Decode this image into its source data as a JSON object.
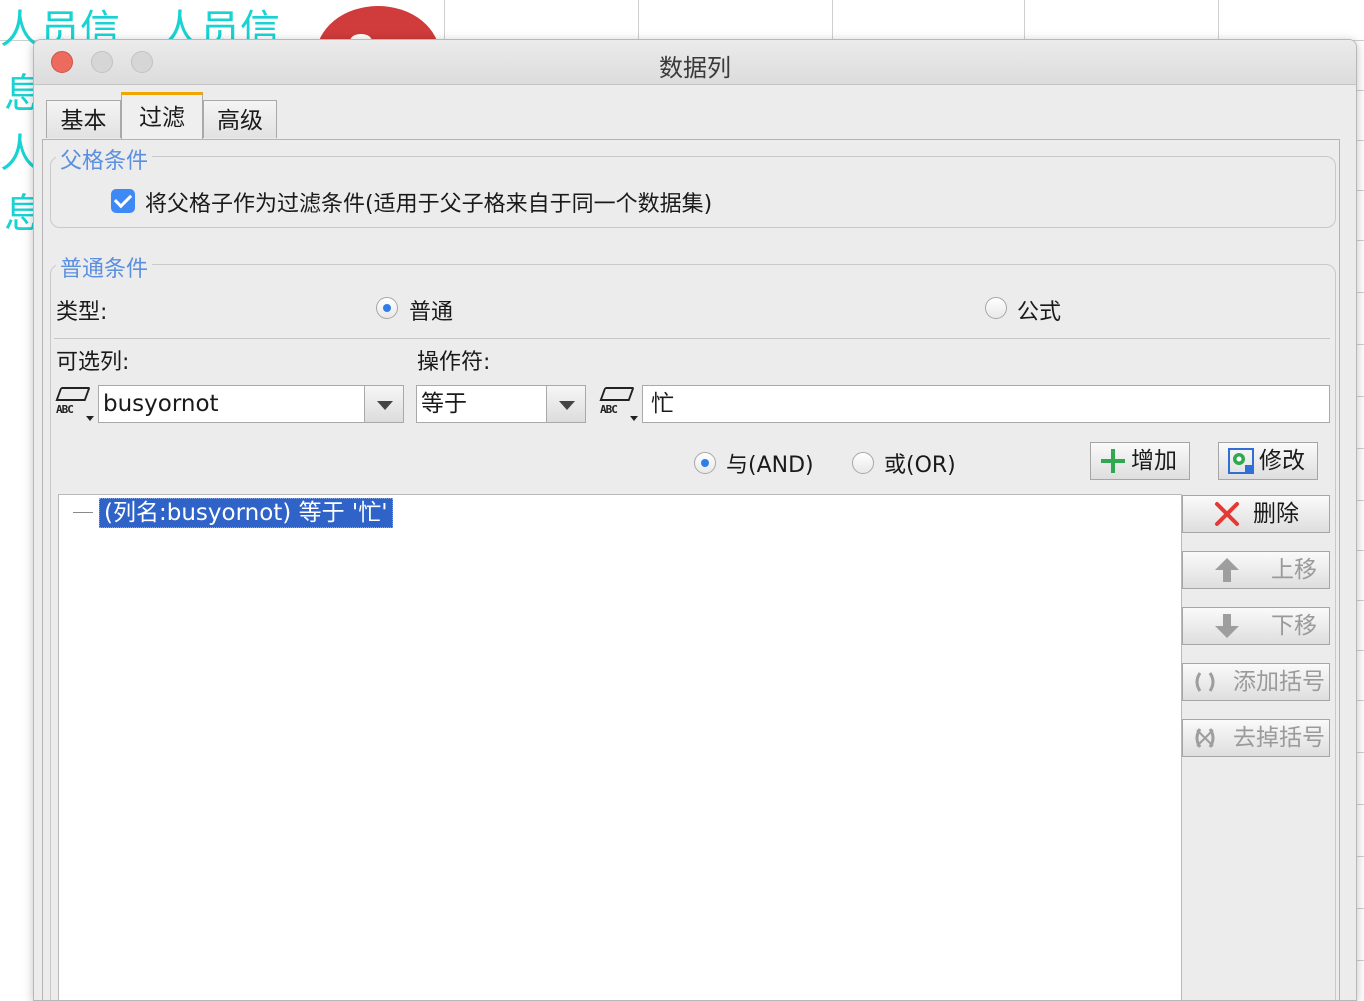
{
  "background": {
    "cyan_texts": [
      "人员信",
      "人员信",
      "息",
      "人",
      "息"
    ]
  },
  "dialog": {
    "title": "数据列",
    "tabs": [
      "基本",
      "过滤",
      "高级"
    ],
    "active_tab": "过滤",
    "parent_group": {
      "title": "父格条件",
      "checkbox_label": "将父格子作为过滤条件(适用于父子格来自于同一个数据集)",
      "checked": true
    },
    "common_group": {
      "title": "普通条件",
      "type_label": "类型:",
      "type_options": [
        "普通",
        "公式"
      ],
      "type_selected": "普通",
      "column_label": "可选列:",
      "operator_label": "操作符:",
      "column_value": "busyornot",
      "operator_value": "等于",
      "value_field": "忙",
      "logic_options": [
        "与(AND)",
        "或(OR)"
      ],
      "logic_selected": "与(AND)",
      "add_button": "增加",
      "modify_button": "修改",
      "delete_button": "删除",
      "up_button": "上移",
      "down_button": "下移",
      "add_bracket_button": "添加括号",
      "remove_bracket_button": "去掉括号",
      "condition_item": "(列名:busyornot) 等于 '忙'"
    }
  },
  "colors": {
    "accent": "#3d8af7",
    "group_title": "#5b8fe0",
    "selection": "#2f63c8",
    "delete_icon": "#e53935",
    "add_icon": "#2fa84f"
  }
}
